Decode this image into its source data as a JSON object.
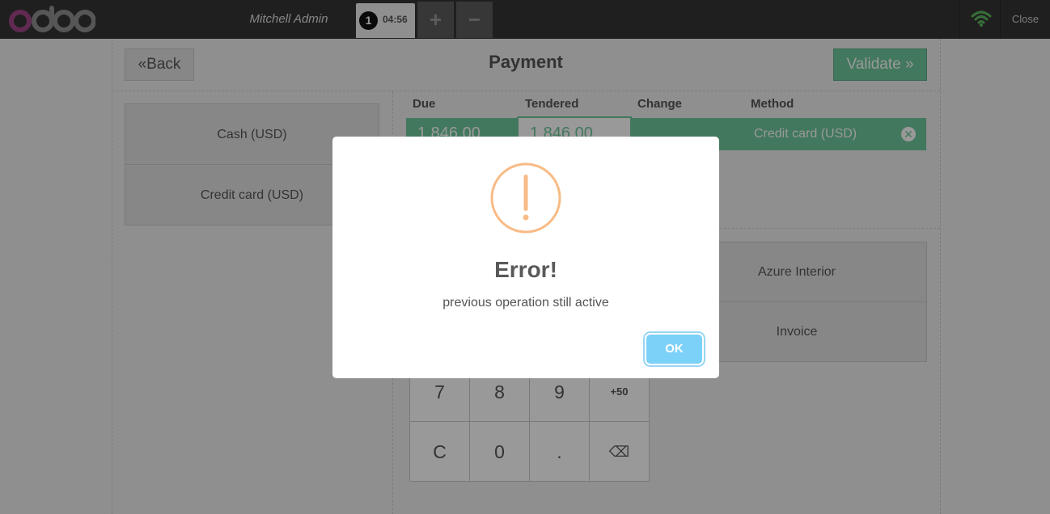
{
  "header": {
    "logo_text": "odoo",
    "cashier": "Mitchell Admin",
    "order": {
      "number": "1",
      "time": "04:56"
    },
    "add_order": "+",
    "remove_order": "−",
    "close_label": "Close",
    "icons": {
      "wifi": "wifi-icon",
      "logo": "odoo-logo"
    },
    "colors": {
      "bar": "#353535",
      "wifi": "#5cb85c",
      "logo_purple": "#a24689",
      "logo_gray": "#8f8f8f"
    }
  },
  "payment": {
    "back_label": "Back",
    "title": "Payment",
    "validate_label": "Validate",
    "methods": [
      "Cash (USD)",
      "Credit card (USD)"
    ],
    "columns": [
      "Due",
      "Tendered",
      "Change",
      "Method"
    ],
    "line": {
      "due": "1,846.00",
      "tendered": "1,846.00",
      "change": "",
      "method": "Credit card (USD)"
    },
    "customer": "Azure Interior",
    "invoice_label": "Invoice",
    "numpad": [
      "7",
      "8",
      "9",
      "+50",
      "C",
      "0",
      ".",
      "⌫"
    ],
    "colors": {
      "accent": "#6ec89b"
    }
  },
  "dialog": {
    "title": "Error!",
    "message": "previous operation still active",
    "ok_label": "OK",
    "icon": "warning-icon",
    "colors": {
      "icon": "#f8bb86",
      "button": "#7cd1f9"
    }
  }
}
